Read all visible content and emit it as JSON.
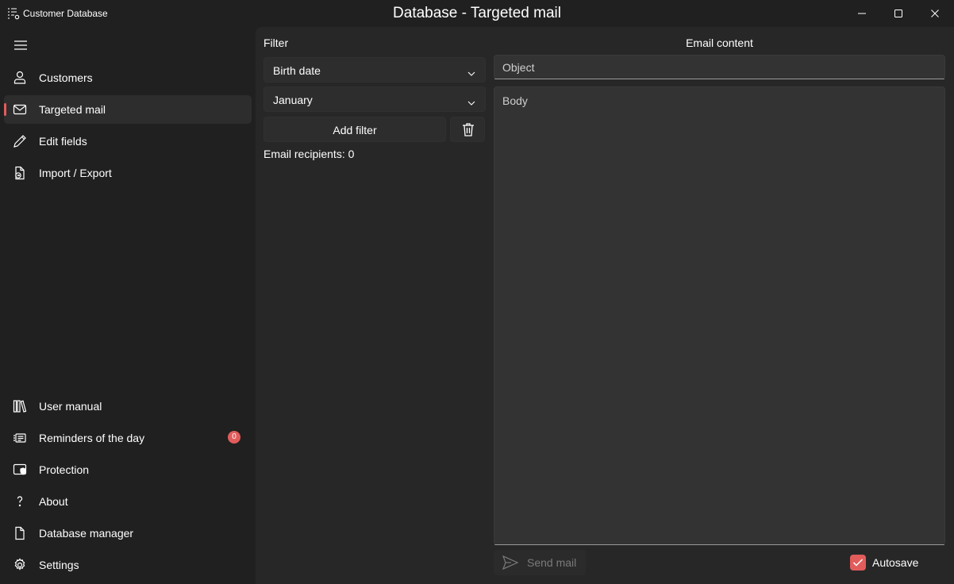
{
  "titlebar": {
    "app_name": "Customer Database",
    "window_title": "Database - Targeted mail"
  },
  "sidebar": {
    "top_items": [
      {
        "label": "Customers",
        "icon": "person-icon"
      },
      {
        "label": "Targeted mail",
        "icon": "mail-icon",
        "selected": true
      },
      {
        "label": "Edit fields",
        "icon": "pencil-icon"
      },
      {
        "label": "Import / Export",
        "icon": "import-export-icon"
      }
    ],
    "bottom_items": [
      {
        "label": "User manual",
        "icon": "library-icon"
      },
      {
        "label": "Reminders of the day",
        "icon": "reminders-icon",
        "badge": "0"
      },
      {
        "label": "Protection",
        "icon": "shield-icon"
      },
      {
        "label": "About",
        "icon": "question-icon"
      },
      {
        "label": "Database manager",
        "icon": "document-icon"
      },
      {
        "label": "Settings",
        "icon": "gear-icon"
      }
    ]
  },
  "filter": {
    "heading": "Filter",
    "field_value": "Birth date",
    "month_value": "January",
    "add_filter_label": "Add filter",
    "recipients_text": "Email recipients: 0"
  },
  "email": {
    "heading": "Email content",
    "object_placeholder": "Object",
    "body_placeholder": "Body",
    "send_label": "Send mail",
    "autosave_label": "Autosave",
    "autosave_checked": true
  },
  "colors": {
    "accent": "#e25c5c",
    "background": "#202020",
    "content": "#272727"
  }
}
